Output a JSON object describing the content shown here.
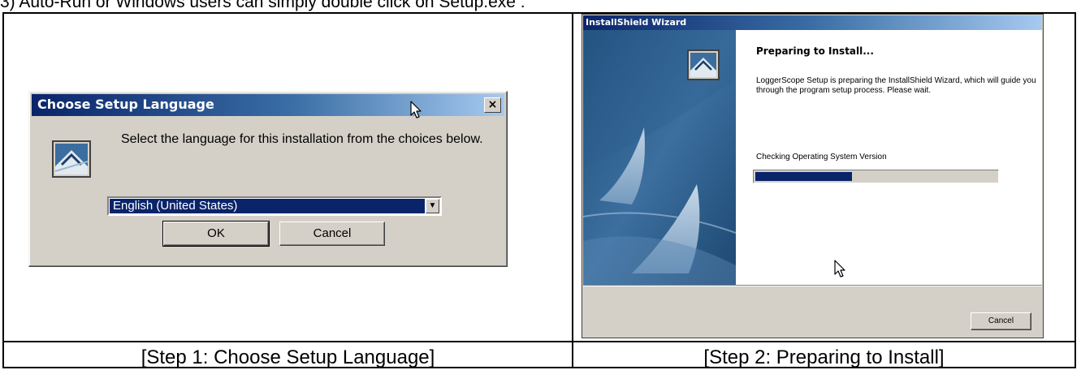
{
  "heading": "3) Auto-Run or Windows users can simply double click on Setup.exe :",
  "captions": {
    "step1": "[Step 1: Choose Setup Language]",
    "step2": "[Step 2: Preparing to Install]"
  },
  "language_dialog": {
    "title": "Choose Setup Language",
    "close_glyph": "×",
    "icon": "installshield-setup-icon",
    "message": "Select the language for this installation from the choices below.",
    "selected_language": "English (United States)",
    "dropdown_glyph": "▼",
    "ok_label": "OK",
    "cancel_label": "Cancel"
  },
  "wizard_dialog": {
    "title": "InstallShield Wizard",
    "icon": "installshield-setup-icon",
    "heading": "Preparing to Install...",
    "body": "LoggerScope Setup is preparing the InstallShield Wizard, which will guide you through the program setup process. Please wait.",
    "status": "Checking Operating System Version",
    "progress_fraction": 0.4,
    "cancel_label": "Cancel"
  },
  "colors": {
    "title_bar": "#0a246a",
    "dialog_face": "#d4d0c8",
    "selection": "#0a246a",
    "progress": "#0a246a"
  }
}
